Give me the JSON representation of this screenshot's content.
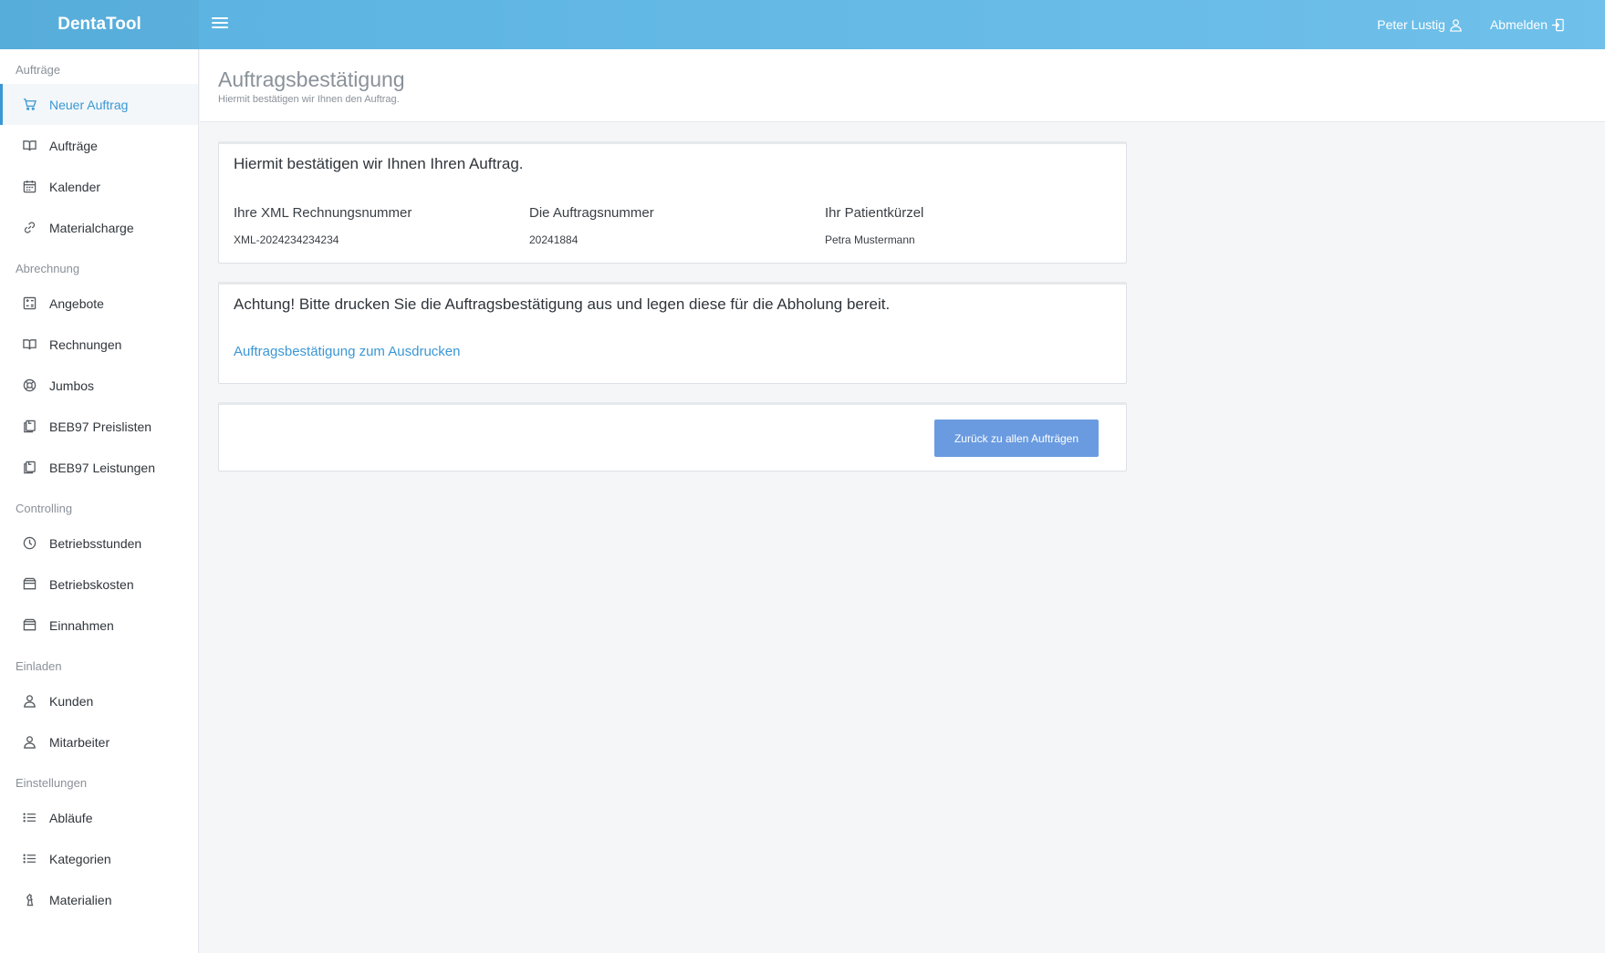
{
  "app": {
    "brand": "DentaTool",
    "user_name": "Peter Lustig",
    "logout_label": "Abmelden"
  },
  "sidebar": {
    "sections": [
      {
        "title": "Aufträge",
        "items": [
          {
            "label": "Neuer Auftrag",
            "icon": "cart-icon",
            "active": true
          },
          {
            "label": "Aufträge",
            "icon": "book-icon"
          },
          {
            "label": "Kalender",
            "icon": "calendar-icon"
          },
          {
            "label": "Materialcharge",
            "icon": "link-icon"
          }
        ]
      },
      {
        "title": "Abrechnung",
        "items": [
          {
            "label": "Angebote",
            "icon": "calculator-icon"
          },
          {
            "label": "Rechnungen",
            "icon": "book-icon"
          },
          {
            "label": "Jumbos",
            "icon": "lifebuoy-icon"
          },
          {
            "label": "BEB97 Preislisten",
            "icon": "documents-icon"
          },
          {
            "label": "BEB97 Leistungen",
            "icon": "documents-icon"
          }
        ]
      },
      {
        "title": "Controlling",
        "items": [
          {
            "label": "Betriebsstunden",
            "icon": "clock-icon"
          },
          {
            "label": "Betriebskosten",
            "icon": "wallet-icon"
          },
          {
            "label": "Einnahmen",
            "icon": "wallet-icon"
          }
        ]
      },
      {
        "title": "Einladen",
        "items": [
          {
            "label": "Kunden",
            "icon": "user-icon"
          },
          {
            "label": "Mitarbeiter",
            "icon": "user-icon"
          }
        ]
      },
      {
        "title": "Einstellungen",
        "items": [
          {
            "label": "Abläufe",
            "icon": "list-icon"
          },
          {
            "label": "Kategorien",
            "icon": "list-icon"
          },
          {
            "label": "Materialien",
            "icon": "chess-icon"
          }
        ]
      }
    ]
  },
  "header": {
    "title": "Auftragsbestätigung",
    "subtitle": "Hiermit bestätigen wir Ihnen den Auftrag."
  },
  "confirmation": {
    "title": "Hiermit bestätigen wir Ihnen Ihren Auftrag.",
    "columns": [
      {
        "label": "Ihre XML Rechnungsnummer",
        "value": "XML-2024234234234"
      },
      {
        "label": "Die Auftragsnummer",
        "value": "20241884"
      },
      {
        "label": "Ihr Patientkürzel",
        "value": "Petra Mustermann"
      }
    ]
  },
  "notice": {
    "title": "Achtung! Bitte drucken Sie die Auftragsbestätigung aus und legen diese für die Abholung bereit.",
    "print_link": "Auftragsbestätigung zum Ausdrucken"
  },
  "actions": {
    "back_label": "Zurück zu allen Aufträgen"
  },
  "colors": {
    "topbar": "#5ab2e0",
    "accent": "#3a97d4",
    "button": "#6a9be0"
  }
}
